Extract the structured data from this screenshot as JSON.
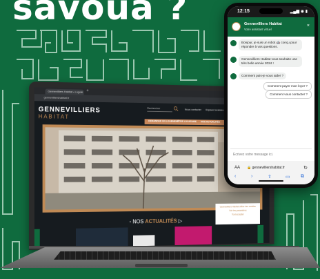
{
  "headline": "savoua ?",
  "laptop": {
    "browser": {
      "tab_title": "Gennevilliers Habitat • Logem",
      "tab_close": "×",
      "new_tab": "+",
      "url": "gennevilliershabitat.fr"
    },
    "site": {
      "logo_line1": "GENNEVILLIERS",
      "logo_line2": "HABITAT",
      "search_placeholder": "Rechercher",
      "top_links": [
        "Nous contacter",
        "Espace locataire"
      ],
      "nav_items": [
        "DEMANDER UN LOGEMENT",
        "ÊTRE LOCATAIRE",
        "NOS ACTUALITÉS",
        "QUI SOMMES-NOUS"
      ],
      "section_title_prefix": "NOS",
      "section_title_accent": "ACTUALITÉS",
      "cookie_lines": [
        "Gennevilliers Habitat utilise des cookies",
        "Voir les paramètres",
        "Tout accepter"
      ]
    }
  },
  "phone": {
    "status_time": "12:15",
    "status_icons": "▂▄▆ ◉ ▮",
    "chat_header_title": "Gennevilliers Habitat",
    "chat_header_subtitle": "Votre assistant virtuel",
    "close_label": "×",
    "bot_messages": [
      "Bonjour, je suis un robot 🤖 conçu pour répondre à vos questions.",
      "Gennevilliers Habitat vous souhaite une très belle année 2024 !",
      "Comment puis-je vous aider ?"
    ],
    "quick_replies": [
      "Comment payer mon loyer ?",
      "Comment vous contacter ?"
    ],
    "input_placeholder": "Ecrivez votre message ici.",
    "safari": {
      "aa": "AA",
      "url": "🔒 gennevilliershabitat.fr",
      "reload": "↻",
      "nav_icons": [
        "‹",
        "›",
        "⇧",
        "▭",
        "⧉"
      ]
    }
  },
  "colors": {
    "brand_green": "#0f6b3e",
    "brand_copper": "#c08a55"
  }
}
